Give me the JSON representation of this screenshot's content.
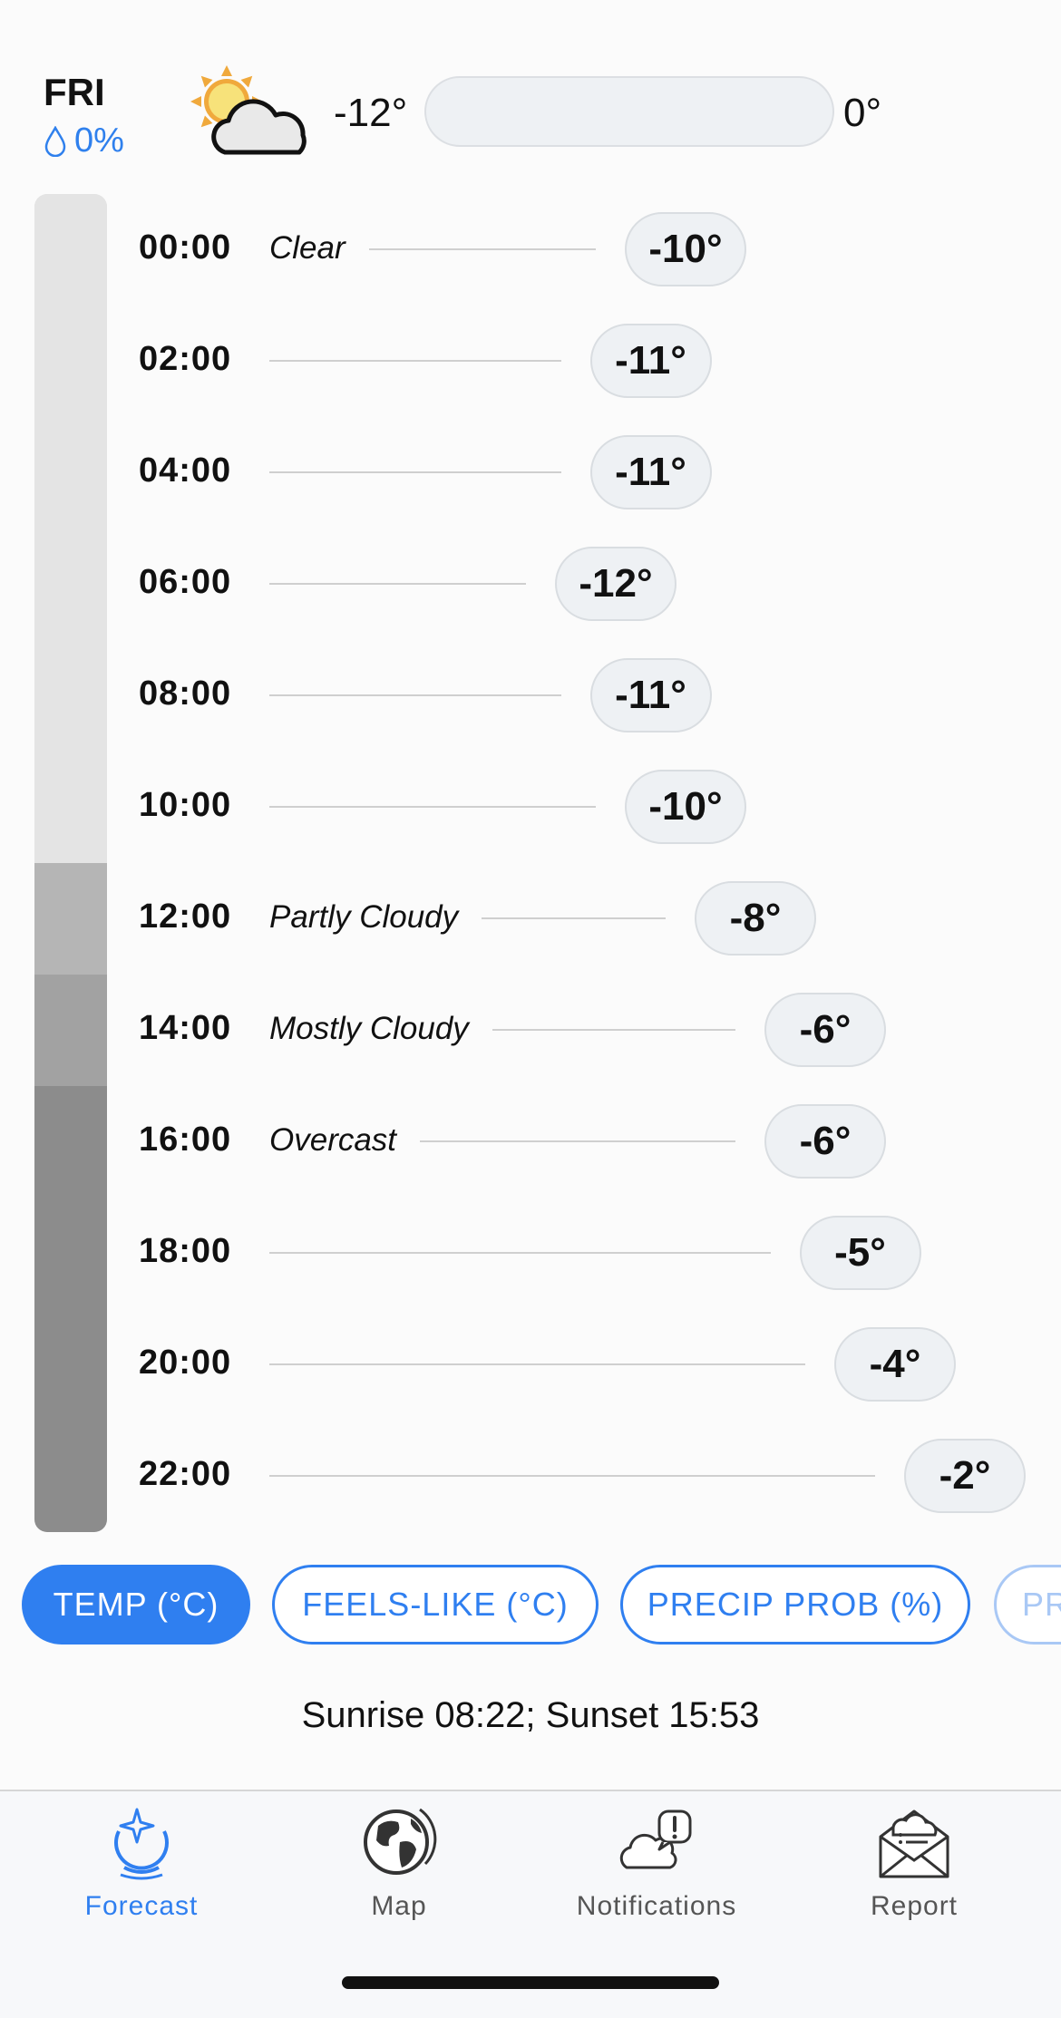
{
  "day": {
    "name": "FRI",
    "precip": "0%",
    "min": "-12°",
    "max": "0°",
    "icon": "partly-cloudy-sun-icon"
  },
  "hours": [
    {
      "time": "00:00",
      "condition": "Clear",
      "temp": "-10°"
    },
    {
      "time": "02:00",
      "condition": "",
      "temp": "-11°"
    },
    {
      "time": "04:00",
      "condition": "",
      "temp": "-11°"
    },
    {
      "time": "06:00",
      "condition": "",
      "temp": "-12°"
    },
    {
      "time": "08:00",
      "condition": "",
      "temp": "-11°"
    },
    {
      "time": "10:00",
      "condition": "",
      "temp": "-10°"
    },
    {
      "time": "12:00",
      "condition": "Partly Cloudy",
      "temp": "-8°"
    },
    {
      "time": "14:00",
      "condition": "Mostly Cloudy",
      "temp": "-6°"
    },
    {
      "time": "16:00",
      "condition": "Overcast",
      "temp": "-6°"
    },
    {
      "time": "18:00",
      "condition": "",
      "temp": "-5°"
    },
    {
      "time": "20:00",
      "condition": "",
      "temp": "-4°"
    },
    {
      "time": "22:00",
      "condition": "",
      "temp": "-2°"
    }
  ],
  "cloud_cover_colors": [
    "#e4e4e4",
    "#e4e4e4",
    "#e4e4e4",
    "#e4e4e4",
    "#e4e4e4",
    "#e4e4e4",
    "#b5b5b5",
    "#a2a2a2",
    "#8c8c8c",
    "#8c8c8c",
    "#8c8c8c",
    "#8c8c8c"
  ],
  "chips": [
    {
      "label": "TEMP (°C)",
      "active": true
    },
    {
      "label": "FEELS-LIKE (°C)",
      "active": false
    },
    {
      "label": "PRECIP PROB (%)",
      "active": false
    },
    {
      "label": "PR",
      "active": false
    }
  ],
  "sun_info": "Sunrise 08:22; Sunset 15:53",
  "tabs": [
    {
      "label": "Forecast",
      "icon": "forecast-crystal-ball-icon",
      "active": true
    },
    {
      "label": "Map",
      "icon": "globe-icon",
      "active": false
    },
    {
      "label": "Notifications",
      "icon": "cloud-alert-icon",
      "active": false
    },
    {
      "label": "Report",
      "icon": "envelope-icon",
      "active": false
    }
  ],
  "colors": {
    "accent": "#2f7ff0",
    "precip": "#2f80ed",
    "pill_bg": "#eef1f4"
  }
}
